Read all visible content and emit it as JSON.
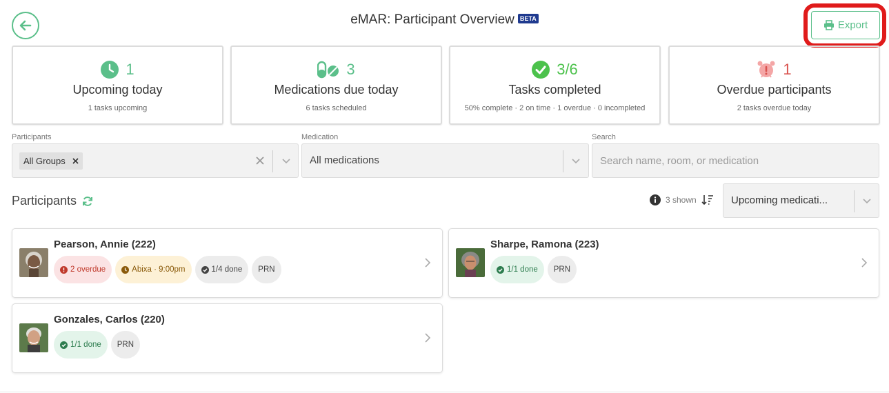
{
  "header": {
    "title": "eMAR: Participant Overview",
    "beta_label": "BETA",
    "export_label": "Export"
  },
  "stats": [
    {
      "icon": "clock-icon",
      "value": "1",
      "label": "Upcoming today",
      "sub": "1 tasks upcoming",
      "color": "#5bbf8a"
    },
    {
      "icon": "pills-icon",
      "value": "3",
      "label": "Medications due today",
      "sub": "6 tasks scheduled",
      "color": "#5bbf8a"
    },
    {
      "icon": "check-circle-icon",
      "value": "3/6",
      "label": "Tasks completed",
      "sub": "50% complete · 2 on time · 1 overdue · 0 incompleted",
      "color": "#4cc24c"
    },
    {
      "icon": "alarm-clock-icon",
      "value": "1",
      "label": "Overdue participants",
      "sub": "2 tasks overdue today",
      "color": "#d9534f"
    }
  ],
  "filters": {
    "participants_label": "Participants",
    "participants_chip": "All Groups",
    "medication_label": "Medication",
    "medication_value": "All medications",
    "search_label": "Search",
    "search_placeholder": "Search name, room, or medication"
  },
  "list": {
    "title": "Participants",
    "shown_text": "3 shown",
    "sort_value": "Upcoming medicati..."
  },
  "participants": [
    {
      "name": "Pearson, Annie (222)",
      "badges": {
        "overdue": "2 overdue",
        "upcoming": "Abixa · 9:00pm",
        "done": "1/4 done",
        "prn": "PRN"
      }
    },
    {
      "name": "Sharpe, Ramona (223)",
      "badges": {
        "done": "1/1 done",
        "prn": "PRN"
      }
    },
    {
      "name": "Gonzales, Carlos (220)",
      "badges": {
        "done": "1/1 done",
        "prn": "PRN"
      }
    }
  ],
  "colors": {
    "accent": "#5bbf8a",
    "danger": "#d9534f",
    "highlight": "#e01b1b",
    "beta": "#1f3a8f"
  }
}
